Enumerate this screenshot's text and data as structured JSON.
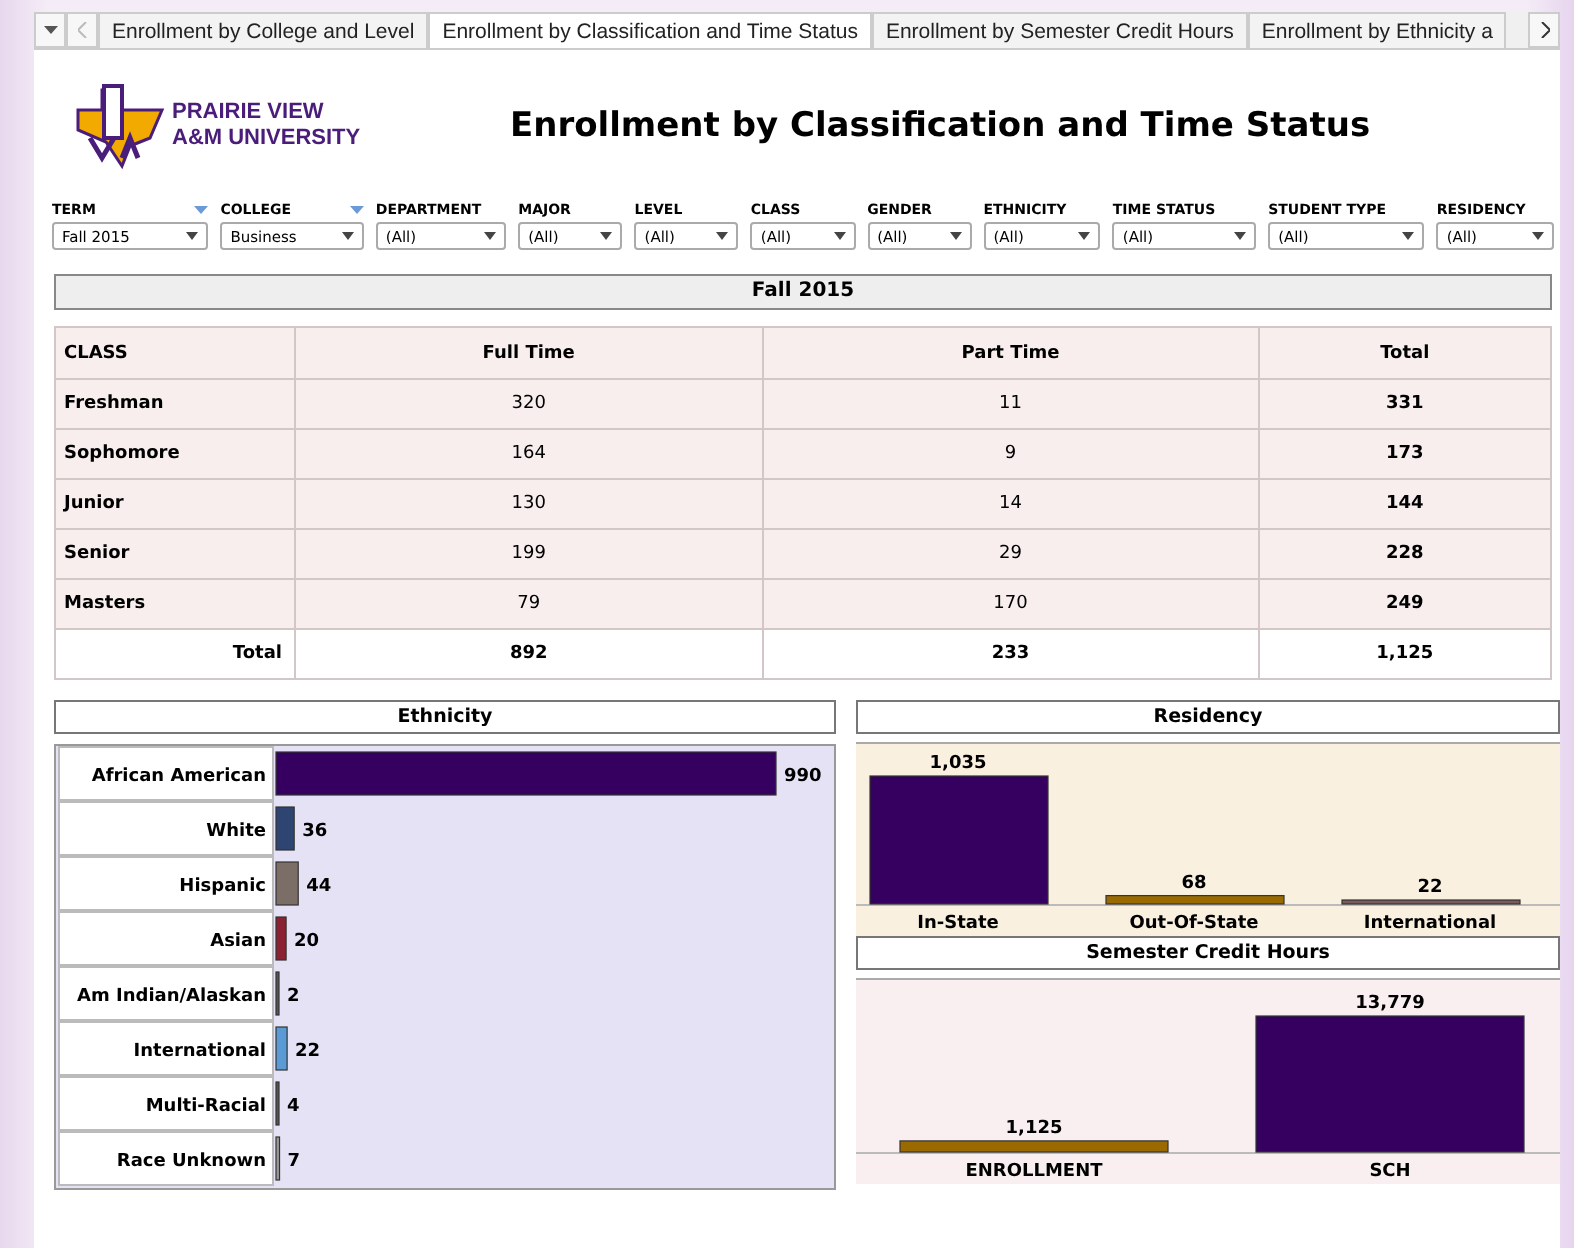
{
  "tabs": [
    {
      "label": "Enrollment by College and Level",
      "selected": false
    },
    {
      "label": "Enrollment by Classification and Time Status",
      "selected": true
    },
    {
      "label": "Enrollment by Semester Credit Hours",
      "selected": false
    },
    {
      "label": "Enrollment by Ethnicity a",
      "selected": false
    }
  ],
  "logo": {
    "line1": "PRAIRIE VIEW",
    "line2": "A&M UNIVERSITY"
  },
  "title": "Enrollment by Classification and Time Status",
  "filters": [
    {
      "label": "TERM",
      "value": "Fall 2015",
      "menu": true
    },
    {
      "label": "COLLEGE",
      "value": "Business",
      "menu": true
    },
    {
      "label": "DEPARTMENT",
      "value": "(All)",
      "menu": false
    },
    {
      "label": "MAJOR",
      "value": "(All)",
      "menu": false
    },
    {
      "label": "LEVEL",
      "value": "(All)",
      "menu": false
    },
    {
      "label": "CLASS",
      "value": "(All)",
      "menu": false
    },
    {
      "label": "GENDER",
      "value": "(All)",
      "menu": false
    },
    {
      "label": "ETHNICITY",
      "value": "(All)",
      "menu": false
    },
    {
      "label": "TIME STATUS",
      "value": "(All)",
      "menu": false
    },
    {
      "label": "STUDENT TYPE",
      "value": "(All)",
      "menu": false
    },
    {
      "label": "RESIDENCY",
      "value": "(All)",
      "menu": false
    }
  ],
  "table": {
    "heading": "Fall 2015",
    "columns": [
      "CLASS",
      "Full Time",
      "Part Time",
      "Total"
    ],
    "rows": [
      [
        "Freshman",
        "320",
        "11",
        "331"
      ],
      [
        "Sophomore",
        "164",
        "9",
        "173"
      ],
      [
        "Junior",
        "130",
        "14",
        "144"
      ],
      [
        "Senior",
        "199",
        "29",
        "228"
      ],
      [
        "Masters",
        "79",
        "170",
        "249"
      ]
    ],
    "total_row": [
      "Total",
      "892",
      "233",
      "1,125"
    ]
  },
  "ethnicity": {
    "title": "Ethnicity",
    "chart_data": {
      "type": "bar",
      "orientation": "horizontal",
      "categories": [
        "African American",
        "White",
        "Hispanic",
        "Asian",
        "Am Indian/Alaskan",
        "International",
        "Multi-Racial",
        "Race Unknown"
      ],
      "values": [
        990,
        36,
        44,
        20,
        2,
        22,
        4,
        7
      ],
      "data_labels": true
    }
  },
  "residency": {
    "title": "Residency",
    "chart_data": {
      "type": "bar",
      "categories": [
        "In-State",
        "Out-Of-State",
        "International"
      ],
      "values": [
        1035,
        68,
        22
      ],
      "value_labels": [
        "1,035",
        "68",
        "22"
      ]
    }
  },
  "sch": {
    "title": "Semester Credit Hours",
    "chart_data": {
      "type": "bar",
      "categories": [
        "ENROLLMENT",
        "SCH"
      ],
      "values": [
        1125,
        13779
      ],
      "value_labels": [
        "1,125",
        "13,779"
      ]
    }
  }
}
